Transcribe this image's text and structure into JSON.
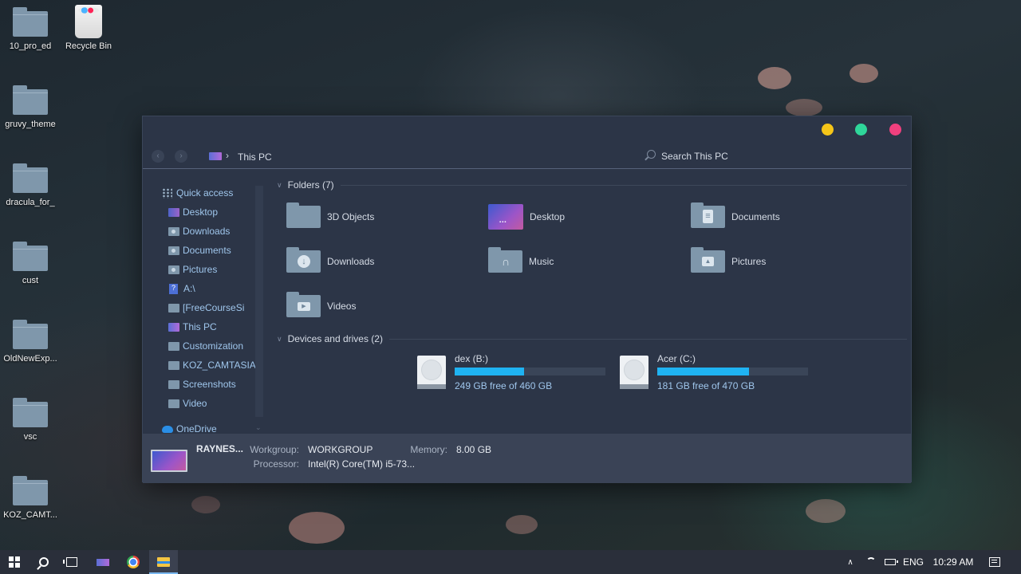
{
  "desktop": {
    "icons": [
      {
        "label": "10_pro_ed",
        "type": "folder"
      },
      {
        "label": "Recycle Bin",
        "type": "recycle-bin"
      },
      {
        "label": "gruvy_theme",
        "type": "folder"
      },
      {
        "label": "dracula_for_",
        "type": "folder"
      },
      {
        "label": "cust",
        "type": "folder"
      },
      {
        "label": "OldNewExp...",
        "type": "folder"
      },
      {
        "label": "vsc",
        "type": "folder"
      },
      {
        "label": "KOZ_CAMT...",
        "type": "folder"
      }
    ]
  },
  "window": {
    "controls": {
      "minimize_color": "#f5c518",
      "maximize_color": "#2fd69a",
      "close_color": "#f0407e"
    },
    "breadcrumb": {
      "icon": "this-pc-icon",
      "separator": "›",
      "label": "This PC"
    },
    "search": {
      "placeholder": "Search This PC"
    }
  },
  "sidebar": {
    "items": [
      {
        "label": "Quick access",
        "icon": "quick-access-icon"
      },
      {
        "label": "Desktop",
        "icon": "desktop-icon"
      },
      {
        "label": "Downloads",
        "icon": "folder-icon"
      },
      {
        "label": "Documents",
        "icon": "folder-icon"
      },
      {
        "label": "Pictures",
        "icon": "folder-icon"
      },
      {
        "label": "A:\\",
        "icon": "unknown-drive-icon"
      },
      {
        "label": "[FreeCourseSi",
        "icon": "folder-icon"
      },
      {
        "label": "This PC",
        "icon": "this-pc-icon"
      },
      {
        "label": "Customization",
        "icon": "folder-icon"
      },
      {
        "label": "KOZ_CAMTASIA_",
        "icon": "folder-icon"
      },
      {
        "label": "Screenshots",
        "icon": "folder-icon"
      },
      {
        "label": "Video",
        "icon": "folder-icon"
      },
      {
        "label": "OneDrive",
        "icon": "onedrive-icon"
      }
    ]
  },
  "main": {
    "folders_header": "Folders (7)",
    "folders": [
      {
        "label": "3D Objects",
        "icon": "folder-icon"
      },
      {
        "label": "Desktop",
        "icon": "desktop-thumbnail"
      },
      {
        "label": "Documents",
        "icon": "documents-folder-icon"
      },
      {
        "label": "Downloads",
        "icon": "downloads-folder-icon"
      },
      {
        "label": "Music",
        "icon": "music-folder-icon"
      },
      {
        "label": "Pictures",
        "icon": "pictures-folder-icon"
      },
      {
        "label": "Videos",
        "icon": "videos-folder-icon"
      }
    ],
    "drives_header": "Devices and drives (2)",
    "drives": [
      {
        "name": "dex (B:)",
        "free_text": "249 GB free of 460 GB",
        "used_fraction": 0.46
      },
      {
        "name": "Acer (C:)",
        "free_text": "181 GB free of 470 GB",
        "used_fraction": 0.61
      }
    ]
  },
  "details": {
    "pc_name": "RAYNES...",
    "workgroup_label": "Workgroup:",
    "workgroup_value": "WORKGROUP",
    "memory_label": "Memory:",
    "memory_value": "8.00 GB",
    "processor_label": "Processor:",
    "processor_value": "Intel(R) Core(TM) i5-73..."
  },
  "taskbar": {
    "tray": {
      "language": "ENG",
      "time": "10:29 AM"
    }
  },
  "colors": {
    "window_bg": "#2c3547",
    "accent_blue": "#1fb3f2",
    "link_blue": "#9fc6ec",
    "folder": "#7f97ab"
  }
}
